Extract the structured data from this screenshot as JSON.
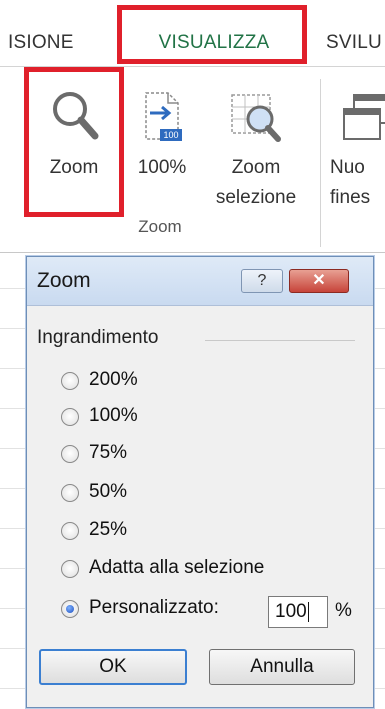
{
  "ribbon": {
    "tabs": [
      "ISIONE",
      "VISUALIZZA",
      "SVILU"
    ],
    "active_tab": "VISUALIZZA",
    "accent_color": "#217346",
    "highlight_color": "#e0202b",
    "buttons": {
      "zoom": "Zoom",
      "hundred": "100%",
      "zoom_selection_line1": "Zoom",
      "zoom_selection_line2": "selezione",
      "new_window_line1": "Nuo",
      "new_window_line2": "fines"
    },
    "group_label": "Zoom"
  },
  "dialog": {
    "title": "Zoom",
    "help_label": "?",
    "close_label": "✕",
    "section": "Ingrandimento",
    "options": [
      {
        "label": "200%",
        "selected": false
      },
      {
        "label": "100%",
        "selected": false
      },
      {
        "label": "75%",
        "selected": false
      },
      {
        "label": "50%",
        "selected": false
      },
      {
        "label": "25%",
        "selected": false
      },
      {
        "label": "Adatta alla selezione",
        "selected": false
      },
      {
        "label": "Personalizzato:",
        "selected": true
      }
    ],
    "custom_value": "100",
    "percent_sign": "%",
    "ok_label": "OK",
    "cancel_label": "Annulla"
  }
}
